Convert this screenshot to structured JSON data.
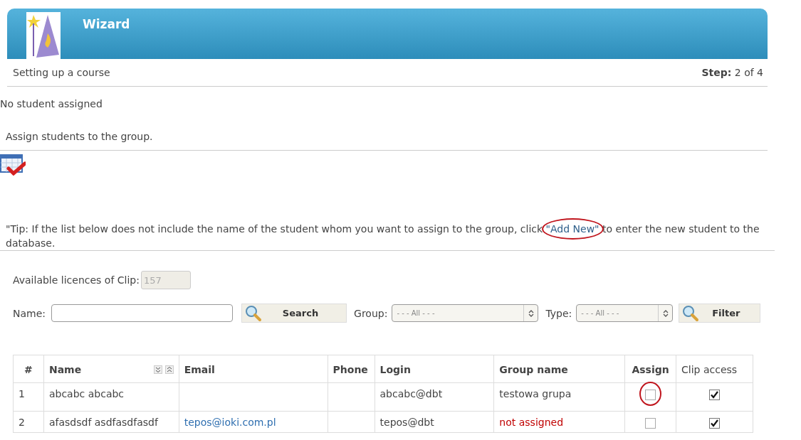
{
  "header": {
    "title": "Wizard"
  },
  "subheader": {
    "label": "Setting up a course",
    "step_label": "Step:",
    "step_value": "2 of 4"
  },
  "status": "No student assigned",
  "section": {
    "title": "Assign students to the group."
  },
  "tip": {
    "before": "\"Tip: If the list below does not include the name of the student whom you want to assign to the group, click",
    "link": "\"Add New\"",
    "link_highlighted": true,
    "after": "to enter the new student to the database."
  },
  "licences": {
    "label": "Available licences of Clip:",
    "value": "157"
  },
  "filters": {
    "name_label": "Name:",
    "search_button": "Search",
    "group_label": "Group:",
    "group_value": "- - - All - - -",
    "type_label": "Type:",
    "type_value": "- - - All - - -",
    "filter_button": "Filter"
  },
  "table": {
    "columns": [
      "#",
      "Name",
      "Email",
      "Phone",
      "Login",
      "Group name",
      "Assign",
      "Clip access"
    ],
    "rows": [
      {
        "number": "1",
        "name": "abcabc abcabc",
        "email": "",
        "phone": "",
        "login": "abcabc@dbt",
        "group": "testowa grupa",
        "group_assigned": true,
        "assign": false,
        "assign_highlighted": true,
        "clip_access": true
      },
      {
        "number": "2",
        "name": "afasdsdf asdfasdfasdf",
        "email": "tepos@ioki.com.pl",
        "phone": "",
        "login": "tepos@dbt",
        "group": "not assigned",
        "group_assigned": false,
        "assign": false,
        "assign_highlighted": false,
        "clip_access": true
      }
    ]
  }
}
